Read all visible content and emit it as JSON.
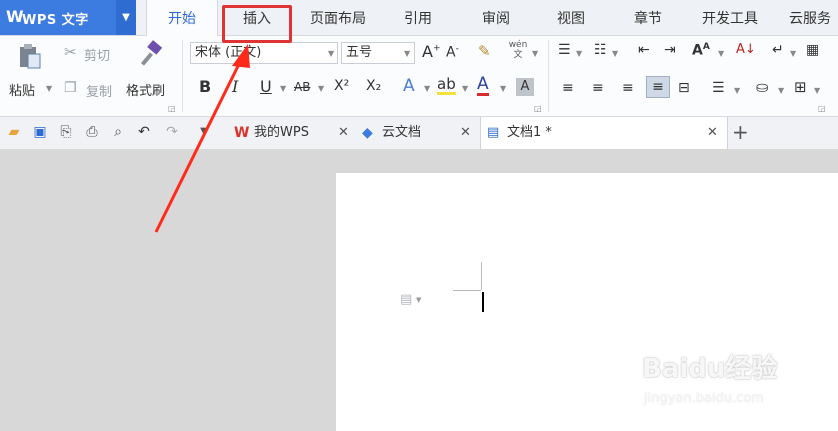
{
  "app": {
    "logo_label": "WPS 文字",
    "logo_mark": "W"
  },
  "menu_tabs": [
    "开始",
    "插入",
    "页面布局",
    "引用",
    "审阅",
    "视图",
    "章节",
    "开发工具",
    "云服务"
  ],
  "ribbon": {
    "paste": "粘贴",
    "cut": "剪切",
    "copy": "复制",
    "format_painter": "格式刷",
    "font_name": "宋体 (正文)",
    "font_size": "五号",
    "bold": "B",
    "italic": "I",
    "underline": "U",
    "strike": "AB",
    "superscript": "X²",
    "subscript": "X₂",
    "pinyin": "wén 文"
  },
  "doc_tabs": [
    "我的WPS",
    "云文档",
    "文档1 *"
  ],
  "watermark": {
    "logo": "Baidu经验",
    "url": "jingyan.baidu.com"
  },
  "colors": {
    "accent": "#3c7be0",
    "highlight": "#e03434",
    "arrow": "#ff2a1a"
  }
}
